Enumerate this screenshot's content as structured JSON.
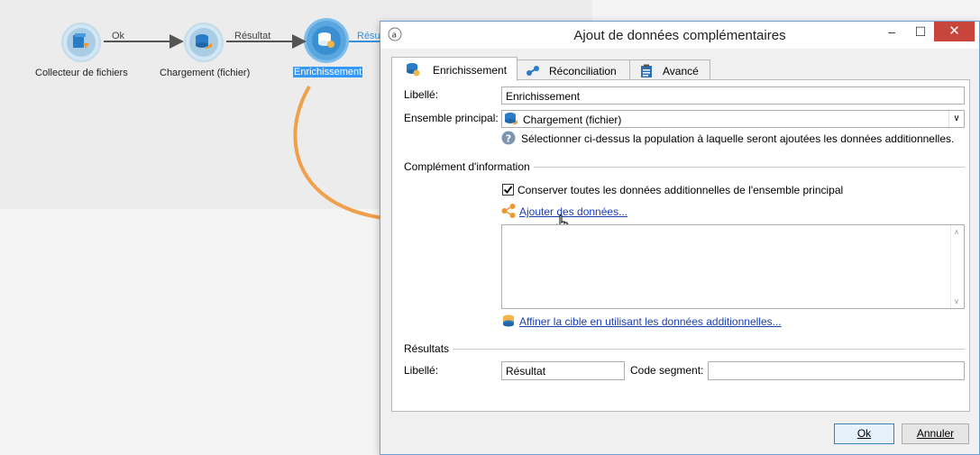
{
  "workflow": {
    "nodes": [
      {
        "label": "Collecteur de fichiers",
        "icon": "file-collector-icon"
      },
      {
        "label": "Chargement (fichier)",
        "icon": "data-load-icon"
      },
      {
        "label": "Enrichissement",
        "icon": "enrichment-icon"
      }
    ],
    "transitions": [
      "Ok",
      "Résultat",
      "Résu"
    ]
  },
  "dialog": {
    "title": "Ajout de données complémentaires",
    "window_controls": {
      "minimize": "–",
      "maximize": "☐",
      "close": "✕"
    },
    "tabs": [
      {
        "label": "Enrichissement",
        "icon": "enrichment-icon",
        "active": true
      },
      {
        "label": "Réconciliation",
        "icon": "link-icon",
        "active": false
      },
      {
        "label": "Avancé",
        "icon": "clipboard-icon",
        "active": false
      }
    ],
    "form": {
      "libelle_label": "Libellé:",
      "libelle_value": "Enrichissement",
      "ensemble_label": "Ensemble principal:",
      "ensemble_value": "Chargement (fichier)",
      "help_text": "Sélectionner ci-dessus la population à laquelle seront ajoutées les données additionnelles.",
      "complement_title": "Complément d'information",
      "keep_checkbox_label": "Conserver toutes les données additionnelles de l'ensemble principal",
      "keep_checked": true,
      "add_data_link": "Ajouter des données...",
      "refine_link": "Affiner la cible en utilisant les données additionnelles...",
      "results_title": "Résultats",
      "result_libelle_label": "Libellé:",
      "result_libelle_value": "Résultat",
      "segment_label": "Code segment:",
      "segment_value": ""
    },
    "buttons": {
      "ok": "Ok",
      "cancel": "Annuler"
    }
  },
  "colors": {
    "accent": "#3399ff",
    "callout_arrow": "#f0a04b",
    "close_button": "#c7453a",
    "link": "#1a3fb5"
  }
}
